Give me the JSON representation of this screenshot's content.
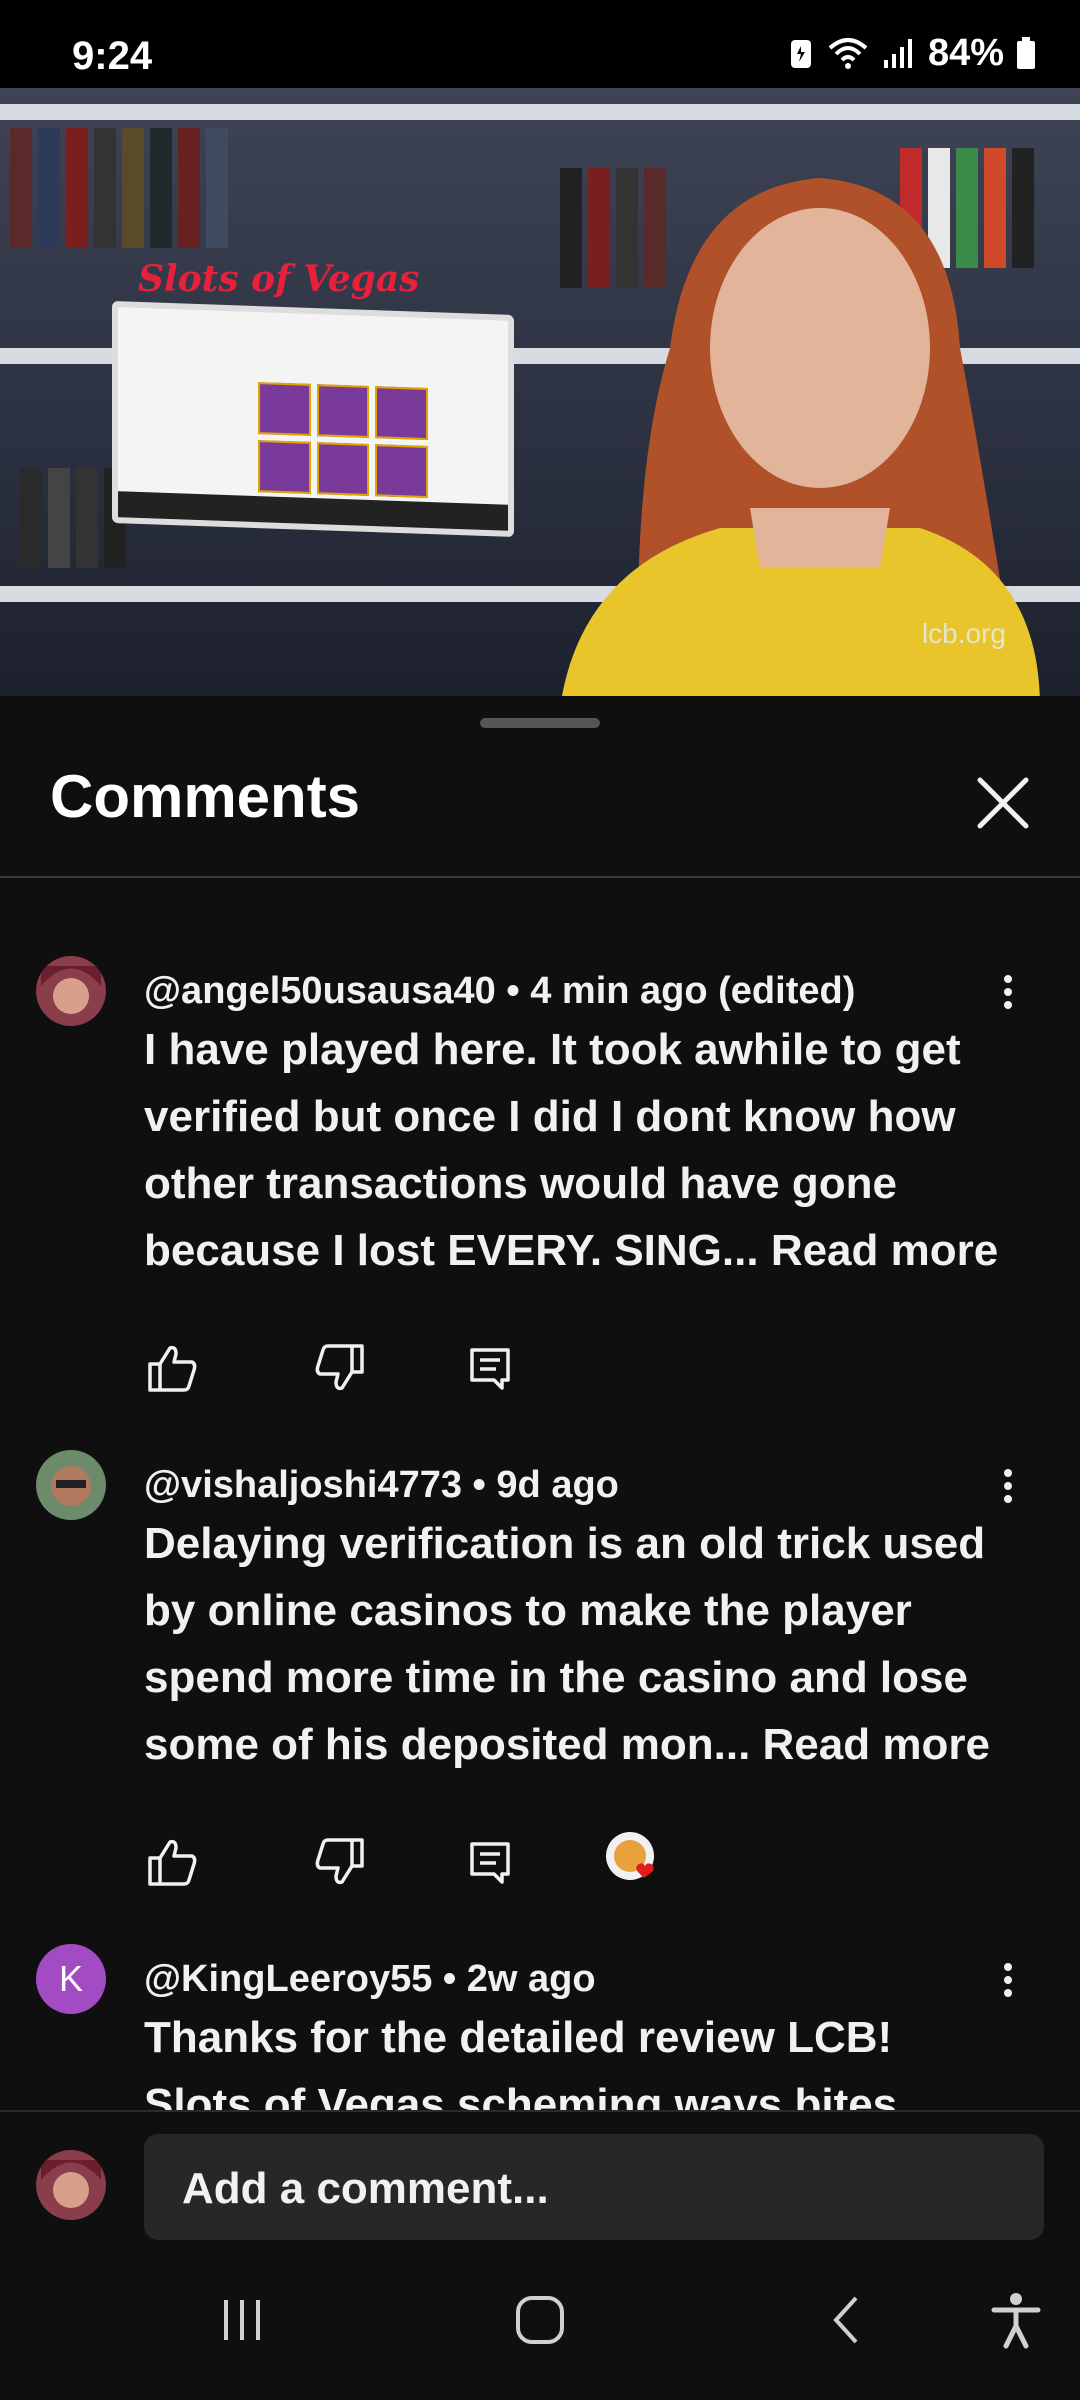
{
  "status_bar": {
    "time": "9:24",
    "battery": "84%"
  },
  "video": {
    "overlay_logo": "Slots of Vegas",
    "watermark": "lcb.org",
    "progress": 0.05
  },
  "panel": {
    "title": "Comments",
    "close_icon": "close-icon"
  },
  "comments": [
    {
      "author": "@angel50usausa40",
      "meta": " • 4 min ago (edited)",
      "text": "I have played here. It took awhile to get verified but once I did I dont know how other transactions would have gone because I lost EVERY. SING... ",
      "read_more": "Read more",
      "avatar_color": "#8a3d4a"
    },
    {
      "author": "@vishaljoshi4773",
      "meta": " • 9d ago",
      "text": "Delaying verification is an old trick used by online casinos to make the player spend more time in the casino and lose some of his deposited mon... ",
      "read_more": "Read more",
      "avatar_color": "#7a6a5a"
    },
    {
      "author": "@KingLeeroy55",
      "meta": " • 2w ago",
      "text": "Thanks for the detailed review LCB! Slots of Vegas scheming ways bites them back",
      "read_more": "",
      "avatar_letter": "K",
      "avatar_color": "#a24bc2"
    }
  ],
  "composer": {
    "placeholder": "Add a comment..."
  },
  "colors": {
    "background": "#0f0f0f",
    "input": "#272727",
    "accent_red": "#ff0000"
  }
}
